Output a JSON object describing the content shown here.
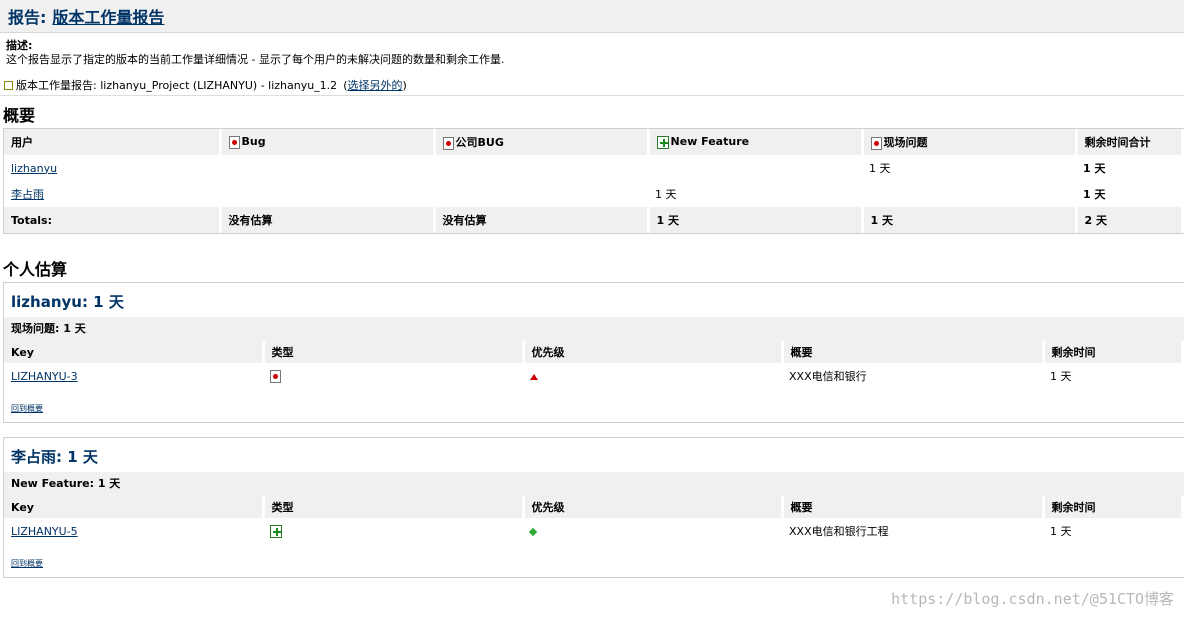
{
  "header": {
    "prefix": "报告:",
    "title": "版本工作量报告"
  },
  "description": {
    "label": "描述:",
    "text": "这个报告显示了指定的版本的当前工作量详细情况 - 显示了每个用户的未解决问题的数量和剩余工作量."
  },
  "report_line": {
    "text": "版本工作量报告: lizhanyu_Project (LIZHANYU) - lizhanyu_1.2",
    "link": "选择另外的"
  },
  "summary": {
    "heading": "概要",
    "columns": [
      {
        "label": "用户",
        "icon": ""
      },
      {
        "label": "Bug",
        "icon": "bug-icon"
      },
      {
        "label": "公司BUG",
        "icon": "bug-icon"
      },
      {
        "label": "New Feature",
        "icon": "new-feature-icon"
      },
      {
        "label": "现场问题",
        "icon": "bug-icon"
      },
      {
        "label": "剩余时间合计",
        "icon": ""
      }
    ],
    "rows": [
      {
        "user": "lizhanyu",
        "cells": [
          "",
          "",
          "",
          "1 天",
          "1 天"
        ]
      },
      {
        "user": "李占雨",
        "cells": [
          "",
          "",
          "1 天",
          "",
          "1 天"
        ]
      }
    ],
    "totals": {
      "label": "Totals:",
      "cells": [
        "没有估算",
        "没有估算",
        "1 天",
        "1 天",
        "2 天"
      ]
    }
  },
  "individual": {
    "heading": "个人估算",
    "users": [
      {
        "title": "lizhanyu: 1 天",
        "group": "现场问题: 1 天",
        "columns": [
          "Key",
          "类型",
          "优先级",
          "概要",
          "剩余时间"
        ],
        "issues": [
          {
            "key": "LIZHANYU-3",
            "type_icon": "bug-icon",
            "priority_icon": "priority-up-icon",
            "summary": "XXX电信和银行",
            "remaining": "1 天"
          }
        ],
        "back": "回到概要"
      },
      {
        "title": "李占雨: 1 天",
        "group": "New Feature: 1 天",
        "columns": [
          "Key",
          "类型",
          "优先级",
          "概要",
          "剩余时间"
        ],
        "issues": [
          {
            "key": "LIZHANYU-5",
            "type_icon": "new-feature-icon",
            "priority_icon": "priority-down-icon",
            "summary": "XXX电信和银行工程",
            "remaining": "1 天"
          }
        ],
        "back": "回到概要"
      }
    ]
  },
  "watermark": "https://blog.csdn.net/@51CTO博客"
}
